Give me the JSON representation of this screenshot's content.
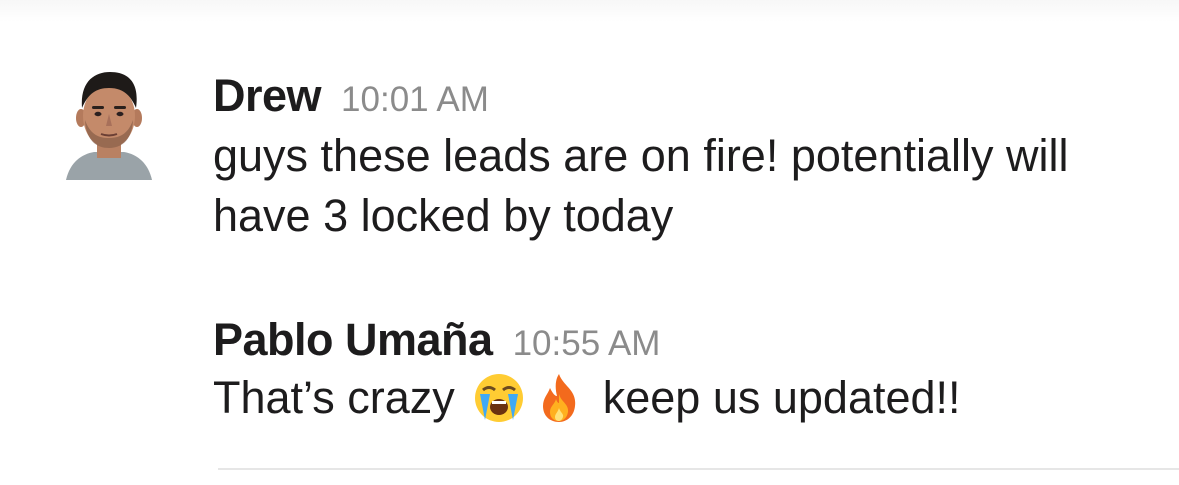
{
  "messages": [
    {
      "author": "Drew",
      "time": "10:01 AM",
      "text": "guys these leads are on fire! potentially will have 3 locked by today",
      "avatar_icon": "person-avatar"
    },
    {
      "author": "Pablo Umaña",
      "time": "10:55 AM",
      "text_before": "That’s crazy",
      "emojis": [
        "loudly-crying-face-icon",
        "fire-icon"
      ],
      "text_after": "keep us updated!!"
    }
  ],
  "colors": {
    "text": "#1d1c1d",
    "timestamp": "#8b8b8b",
    "divider": "#e6e6e6"
  }
}
